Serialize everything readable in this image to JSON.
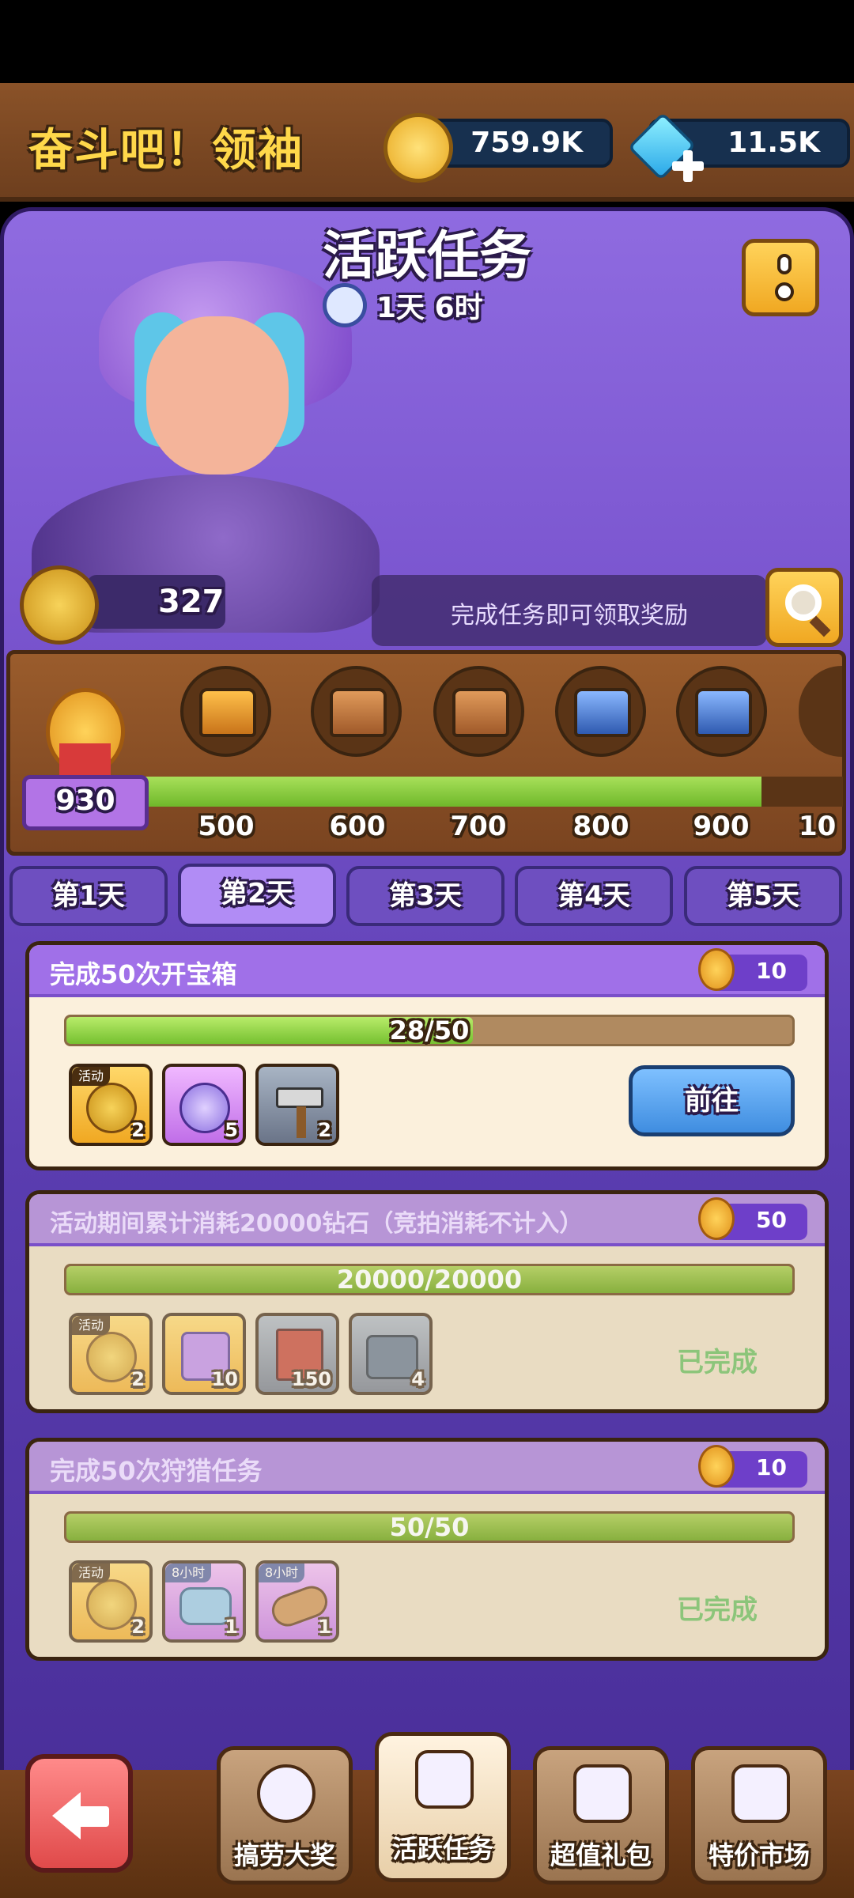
{
  "header": {
    "title": "奋斗吧！领袖",
    "gold": "759.9K",
    "gems": "11.5K"
  },
  "panel": {
    "title": "活跃任务",
    "timer": "1天 6时",
    "points": "327",
    "hint": "完成任务即可领取奖励",
    "score": "930"
  },
  "milestones": [
    "500",
    "600",
    "700",
    "800",
    "900",
    "10"
  ],
  "milestone_progress_percent": 89,
  "tabs": [
    "第1天",
    "第2天",
    "第3天",
    "第4天",
    "第5天"
  ],
  "active_tab": 1,
  "tasks": [
    {
      "name": "完成50次开宝箱",
      "reward_points": "10",
      "progress": "28/50",
      "progress_fraction": 0.56,
      "items": [
        {
          "tag": "活动",
          "count": "2",
          "icon": "event-coin-icon"
        },
        {
          "tag": "",
          "count": "5",
          "icon": "purple-token-icon"
        },
        {
          "tag": "",
          "count": "2",
          "icon": "hammer-icon"
        }
      ],
      "action": "前往"
    },
    {
      "name": "活动期间累计消耗20000钻石（竞拍消耗不计入）",
      "reward_points": "50",
      "progress": "20000/20000",
      "progress_fraction": 1,
      "items": [
        {
          "tag": "活动",
          "count": "2",
          "icon": "event-coin-icon"
        },
        {
          "tag": "",
          "count": "10",
          "icon": "puzzle-icon"
        },
        {
          "tag": "",
          "count": "150",
          "icon": "book-icon"
        },
        {
          "tag": "",
          "count": "4",
          "icon": "chest-icon"
        }
      ],
      "status": "已完成"
    },
    {
      "name": "完成50次狩猎任务",
      "reward_points": "10",
      "progress": "50/50",
      "progress_fraction": 1,
      "items": [
        {
          "tag": "活动",
          "count": "2",
          "icon": "event-coin-icon"
        },
        {
          "tag": "8小时",
          "count": "1",
          "icon": "stone-icon"
        },
        {
          "tag": "8小时",
          "count": "1",
          "icon": "wood-icon"
        }
      ],
      "status": "已完成"
    }
  ],
  "nav": [
    "搞劳大奖",
    "活跃任务",
    "超值礼包",
    "特价市场"
  ],
  "colors": {
    "panel_purple": "#7a55cf",
    "progress_green": "#76c030",
    "gold": "#f7d35a",
    "gem": "#3fc8f5",
    "go_button": "#3f8de0"
  }
}
